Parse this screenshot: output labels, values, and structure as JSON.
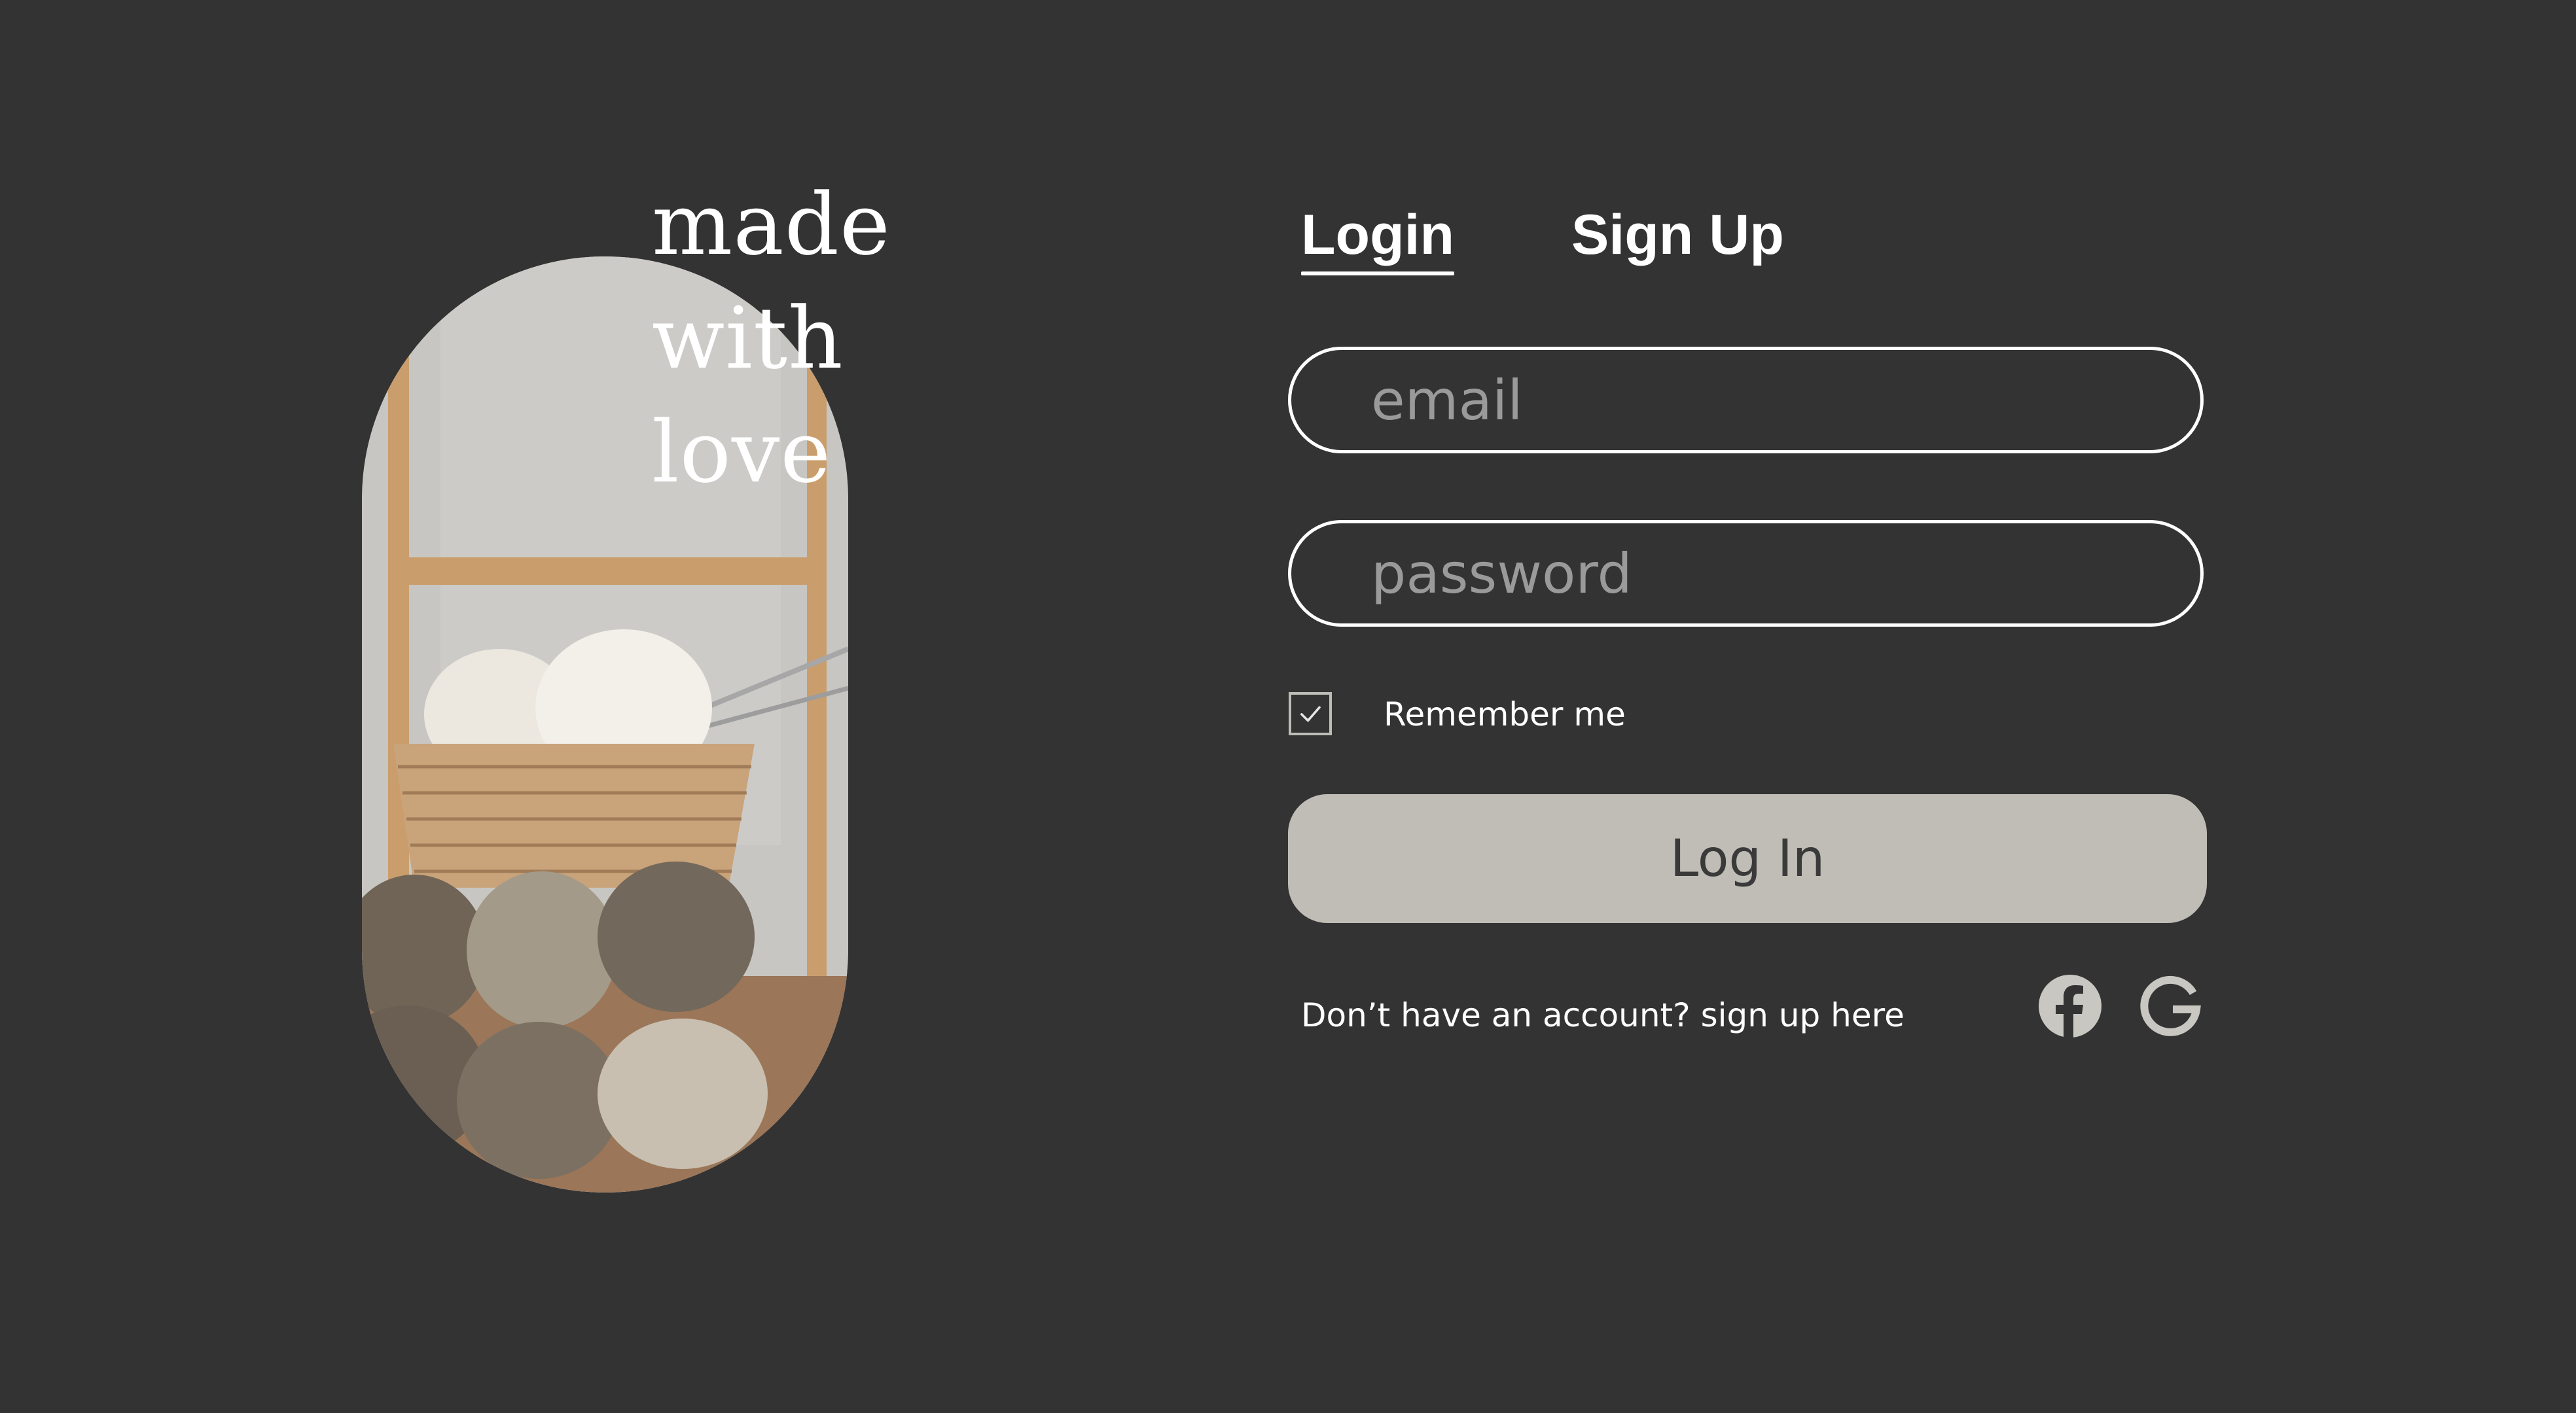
{
  "hero": {
    "tagline": [
      "made",
      "with",
      "love"
    ],
    "image_icon": "yarn-basket-photo"
  },
  "tabs": {
    "login": "Login",
    "signup": "Sign Up"
  },
  "form": {
    "email_placeholder": "email",
    "password_placeholder": "password",
    "remember_label": "Remember me",
    "remember_checked": true,
    "login_button": "Log In"
  },
  "footer": {
    "signup_prompt": "Don’t have an account? sign up here",
    "social_icons": [
      "facebook-icon",
      "google-icon"
    ]
  },
  "colors": {
    "background": "#333333",
    "text": "#ffffff",
    "button": "#c0bdb6",
    "button_text": "#3a3a3a",
    "icon": "#c9c7c2"
  }
}
